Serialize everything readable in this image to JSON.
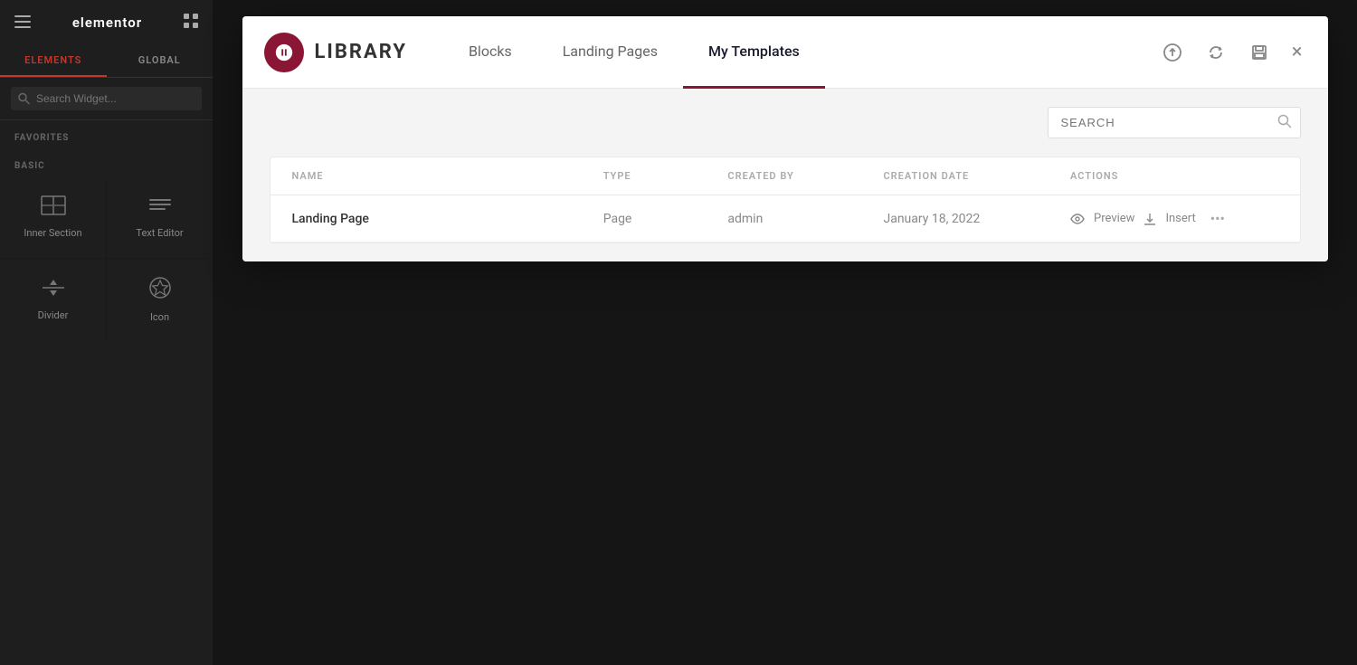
{
  "sidebar": {
    "logo_text": "elementor",
    "tabs": [
      {
        "id": "elements",
        "label": "ELEMENTS",
        "active": true
      },
      {
        "id": "global",
        "label": "GLOBAL",
        "active": false
      }
    ],
    "search": {
      "placeholder": "Search Widget..."
    },
    "sections": [
      {
        "label": "FAVORITES",
        "widgets": []
      },
      {
        "label": "BASIC",
        "widgets": [
          {
            "id": "inner-section",
            "label": "Inner Section",
            "icon": "inner-section-icon"
          },
          {
            "id": "text-editor",
            "label": "Text Editor",
            "icon": "text-editor-icon"
          },
          {
            "id": "divider",
            "label": "Divider",
            "icon": "divider-icon"
          },
          {
            "id": "icon",
            "label": "Icon",
            "icon": "icon-widget-icon"
          }
        ]
      }
    ]
  },
  "modal": {
    "logo_label": "LIBRARY",
    "tabs": [
      {
        "id": "blocks",
        "label": "Blocks",
        "active": false
      },
      {
        "id": "landing-pages",
        "label": "Landing Pages",
        "active": false
      },
      {
        "id": "my-templates",
        "label": "My Templates",
        "active": true
      }
    ],
    "search": {
      "placeholder": "SEARCH"
    },
    "table": {
      "columns": [
        {
          "id": "name",
          "label": "NAME"
        },
        {
          "id": "type",
          "label": "TYPE"
        },
        {
          "id": "created-by",
          "label": "CREATED BY"
        },
        {
          "id": "creation-date",
          "label": "CREATION DATE"
        },
        {
          "id": "actions",
          "label": "ACTIONS"
        }
      ],
      "rows": [
        {
          "name": "Landing Page",
          "type": "Page",
          "created_by": "admin",
          "creation_date": "January 18, 2022",
          "actions": {
            "preview": "Preview",
            "insert": "Insert"
          }
        }
      ]
    },
    "close_label": "×"
  }
}
